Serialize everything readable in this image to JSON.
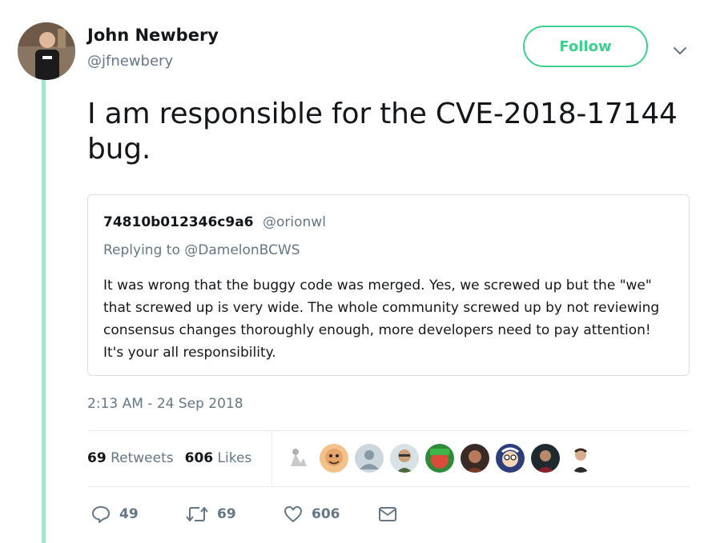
{
  "author": {
    "name": "John Newbery",
    "handle": "@jfnewbery"
  },
  "follow_label": "Follow",
  "tweet_text": "I am responsible for the CVE-2018-17144 bug.",
  "quoted": {
    "name": "74810b012346c9a6",
    "handle": "@orionwl",
    "replying_to": "Replying to @DamelonBCWS",
    "body": "It was wrong that the buggy code was merged. Yes, we screwed up but the \"we\" that screwed up is very wide. The whole community screwed up by not reviewing consensus changes thoroughly enough, more developers need to pay attention! It's your all responsibility."
  },
  "timestamp": "2:13 AM - 24 Sep 2018",
  "stats": {
    "retweets_count": "69",
    "retweets_label": "Retweets",
    "likes_count": "606",
    "likes_label": "Likes"
  },
  "actions": {
    "reply_count": "49",
    "retweet_count": "69",
    "like_count": "606"
  },
  "colors": {
    "accent": "#3ccf8e",
    "thread_line": "#a6e8cf",
    "muted": "#657786"
  },
  "icons": [
    "chevron-down-icon",
    "reply-icon",
    "retweet-icon",
    "heart-icon",
    "mail-icon"
  ]
}
